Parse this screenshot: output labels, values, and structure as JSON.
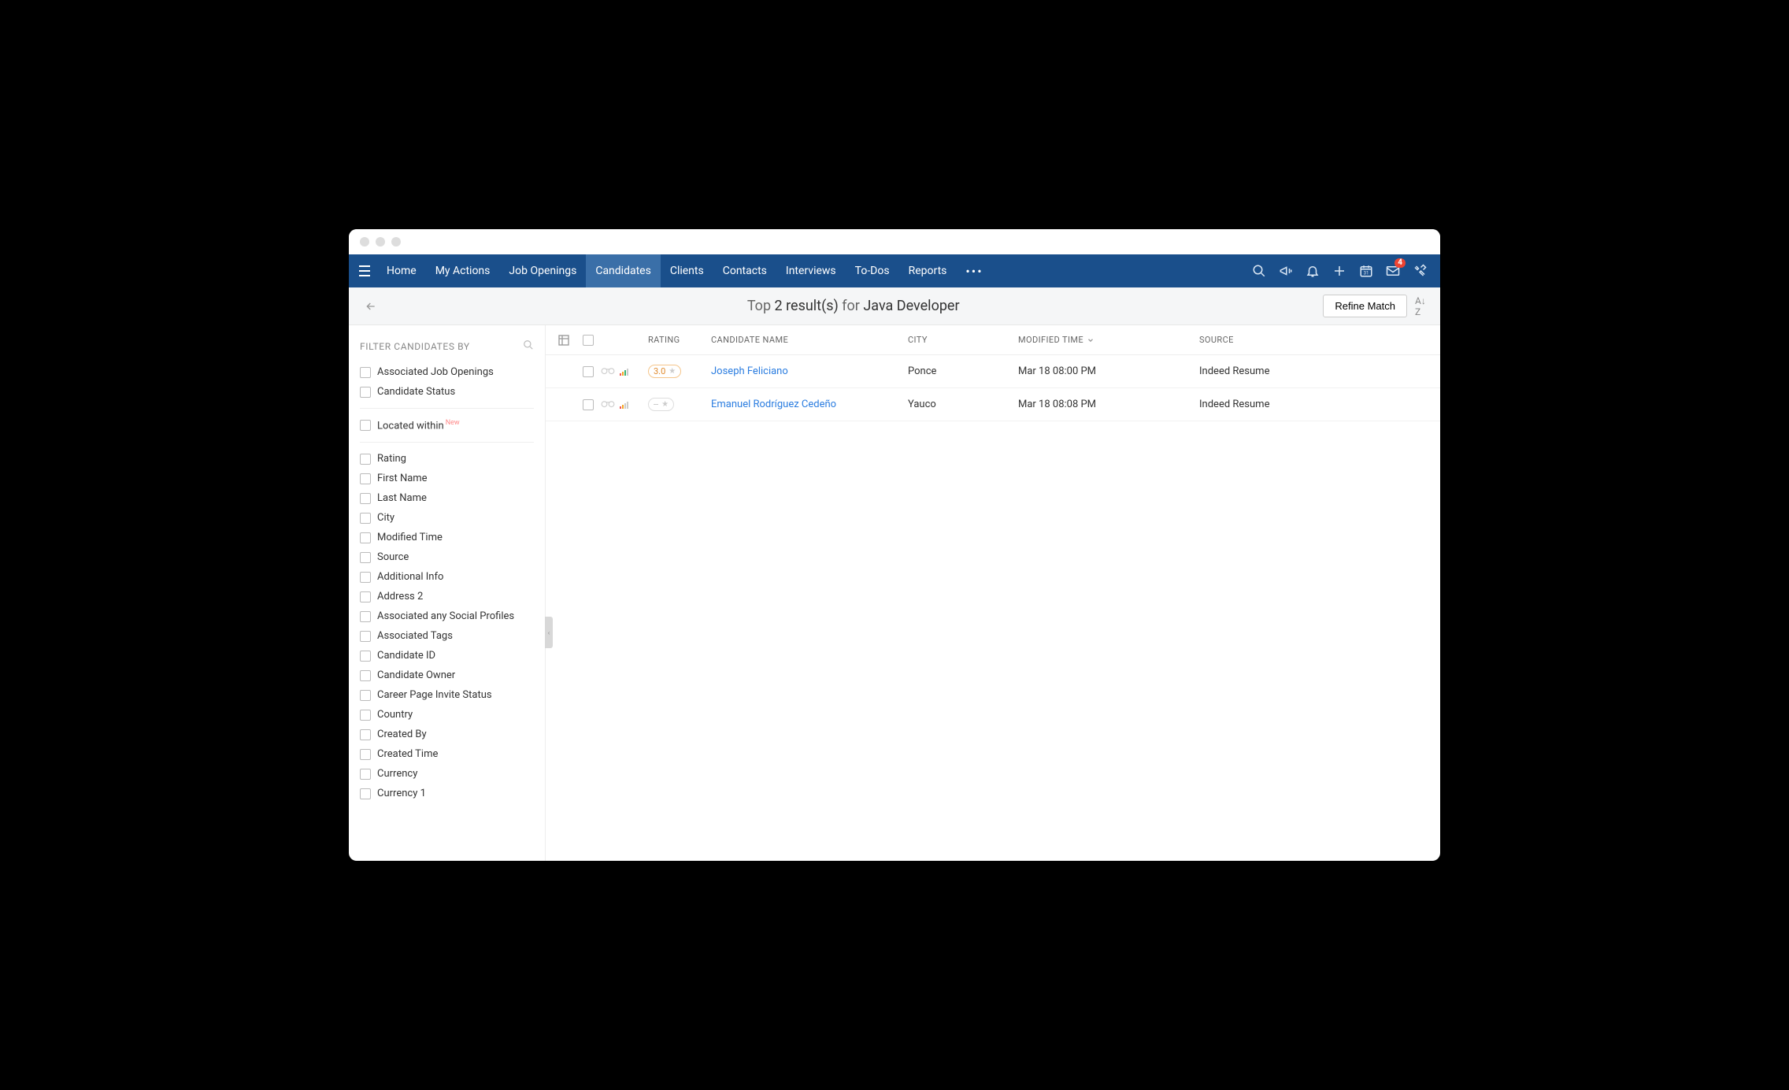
{
  "nav": {
    "items": [
      "Home",
      "My Actions",
      "Job Openings",
      "Candidates",
      "Clients",
      "Contacts",
      "Interviews",
      "To-Dos",
      "Reports"
    ],
    "active_index": 3,
    "mail_badge": "4"
  },
  "subheader": {
    "prefix": "Top",
    "count": "2 result(s)",
    "for_word": "for",
    "term": "Java Developer",
    "refine": "Refine Match"
  },
  "sidebar": {
    "header": "FILTER CANDIDATES BY",
    "group1": [
      "Associated Job Openings",
      "Candidate Status"
    ],
    "located": "Located within",
    "located_tag": "New",
    "group2": [
      "Rating",
      "First Name",
      "Last Name",
      "City",
      "Modified Time",
      "Source",
      "Additional Info",
      "Address 2",
      "Associated any Social Profiles",
      "Associated Tags",
      "Candidate ID",
      "Candidate Owner",
      "Career Page Invite Status",
      "Country",
      "Created By",
      "Created Time",
      "Currency",
      "Currency 1"
    ]
  },
  "table": {
    "headers": {
      "rating": "RATING",
      "name": "CANDIDATE NAME",
      "city": "CITY",
      "time": "MODIFIED TIME",
      "source": "SOURCE"
    },
    "rows": [
      {
        "name": "Joseph Feliciano",
        "city": "Ponce",
        "time": "Mar 18 08:00 PM",
        "source": "Indeed Resume",
        "rating": "3.0"
      },
      {
        "name": "Emanuel Rodríguez Cedeño",
        "city": "Yauco",
        "time": "Mar 18 08:08 PM",
        "source": "Indeed Resume",
        "rating": "--"
      }
    ]
  }
}
